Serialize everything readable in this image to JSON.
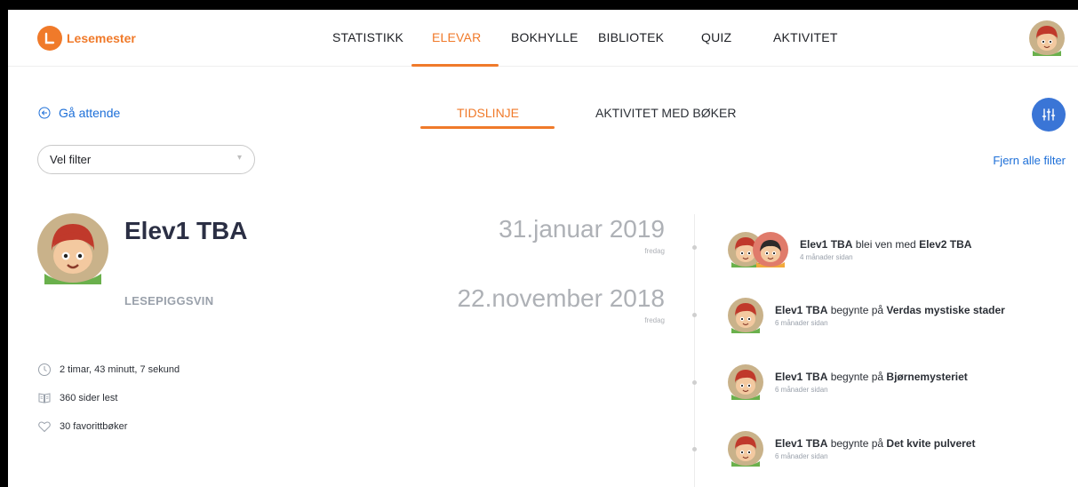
{
  "app": {
    "logo_text": "Lesemester",
    "logo_icon": "bookmark-icon"
  },
  "nav": {
    "items": [
      "STATISTIKK",
      "ELEVAR",
      "BOKHYLLE",
      "BIBLIOTEK",
      "QUIZ",
      "AKTIVITET"
    ],
    "active": "ELEVAR"
  },
  "subnav": {
    "back_label": "Gå attende",
    "tabs": [
      "TIDSLINJE",
      "AKTIVITET MED BØKER"
    ],
    "active_tab": "TIDSLINJE"
  },
  "filter": {
    "value": "Vel filter",
    "clear_label": "Fjern alle filter"
  },
  "student": {
    "name": "Elev1 TBA",
    "level": "LESEPIGGSVIN",
    "stats": {
      "time": "2 timar, 43 minutt, 7 sekund",
      "pages": "360 sider lest",
      "favorites": "30 favorittbøker"
    }
  },
  "timeline": {
    "dates": [
      {
        "date": "31.januar 2019",
        "weekday": "fredag"
      },
      {
        "date": "22.november 2018",
        "weekday": "fredag"
      }
    ],
    "events": [
      {
        "actor": "Elev1 TBA",
        "verb": " blei ven med ",
        "object": "Elev2 TBA",
        "ago": "4 månader sidan"
      },
      {
        "actor": "Elev1 TBA",
        "verb": " begynte på ",
        "object": "Verdas mystiske stader",
        "ago": "6 månader sidan"
      },
      {
        "actor": "Elev1 TBA",
        "verb": " begynte på ",
        "object": "Bjørnemysteriet",
        "ago": "6 månader sidan"
      },
      {
        "actor": "Elev1 TBA",
        "verb": " begynte på ",
        "object": "Det kvite pulveret",
        "ago": "6 månader sidan"
      }
    ]
  },
  "colors": {
    "accent": "#f07a2a",
    "link": "#1d6fd8",
    "button": "#3a75d6",
    "muted": "#aeb1b6"
  }
}
